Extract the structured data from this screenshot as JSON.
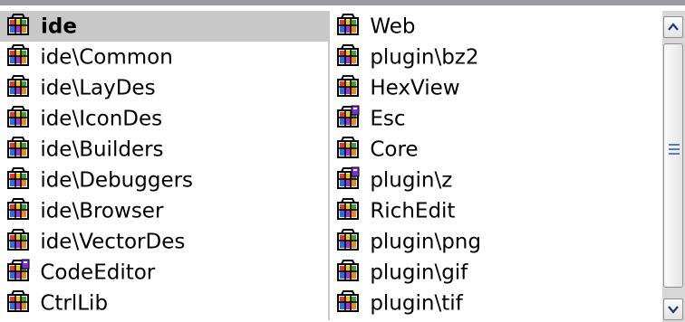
{
  "left_column": [
    {
      "label": "ide",
      "icon": "package-icon",
      "selected": true
    },
    {
      "label": "ide\\Common",
      "icon": "package-icon"
    },
    {
      "label": "ide\\LayDes",
      "icon": "package-icon"
    },
    {
      "label": "ide\\IconDes",
      "icon": "package-icon"
    },
    {
      "label": "ide\\Builders",
      "icon": "package-icon"
    },
    {
      "label": "ide\\Debuggers",
      "icon": "package-icon"
    },
    {
      "label": "ide\\Browser",
      "icon": "package-icon"
    },
    {
      "label": "ide\\VectorDes",
      "icon": "package-icon"
    },
    {
      "label": "CodeEditor",
      "icon": "package-flagged-icon"
    },
    {
      "label": "CtrlLib",
      "icon": "package-icon"
    }
  ],
  "right_column": [
    {
      "label": "Web",
      "icon": "package-icon"
    },
    {
      "label": "plugin\\bz2",
      "icon": "package-icon"
    },
    {
      "label": "HexView",
      "icon": "package-icon"
    },
    {
      "label": "Esc",
      "icon": "package-flagged-icon"
    },
    {
      "label": "Core",
      "icon": "package-icon"
    },
    {
      "label": "plugin\\z",
      "icon": "package-flagged-icon"
    },
    {
      "label": "RichEdit",
      "icon": "package-icon"
    },
    {
      "label": "plugin\\png",
      "icon": "package-icon"
    },
    {
      "label": "plugin\\gif",
      "icon": "package-icon"
    },
    {
      "label": "plugin\\tif",
      "icon": "package-icon"
    }
  ],
  "colors": {
    "selection_bg": "#c8c8c8",
    "scroll_track": "#d7d7d7",
    "scroll_accent": "#5c7cc0"
  }
}
